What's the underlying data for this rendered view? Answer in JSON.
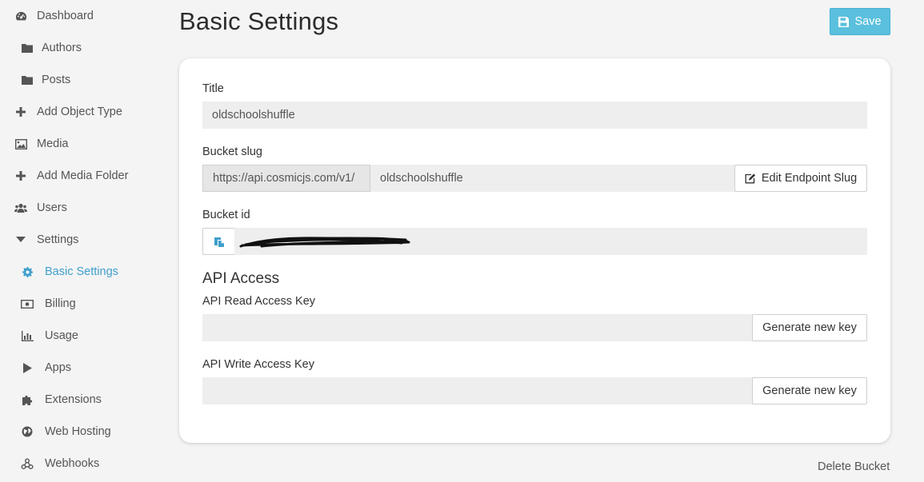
{
  "sidebar": {
    "items": [
      {
        "label": "Dashboard",
        "icon": "dashboard-icon"
      },
      {
        "label": "Authors",
        "icon": "folder-icon"
      },
      {
        "label": "Posts",
        "icon": "folder-icon"
      },
      {
        "label": "Add Object Type",
        "icon": "plus-icon"
      },
      {
        "label": "Media",
        "icon": "image-icon"
      },
      {
        "label": "Add Media Folder",
        "icon": "plus-icon"
      },
      {
        "label": "Users",
        "icon": "users-icon"
      },
      {
        "label": "Settings",
        "icon": "caret-down-icon"
      },
      {
        "label": "Basic Settings",
        "icon": "gear-icon",
        "active": true
      },
      {
        "label": "Billing",
        "icon": "money-icon"
      },
      {
        "label": "Usage",
        "icon": "bar-chart-icon"
      },
      {
        "label": "Apps",
        "icon": "play-icon"
      },
      {
        "label": "Extensions",
        "icon": "puzzle-icon"
      },
      {
        "label": "Web Hosting",
        "icon": "globe-icon"
      },
      {
        "label": "Webhooks",
        "icon": "webhook-icon"
      }
    ]
  },
  "header": {
    "title": "Basic Settings",
    "save_label": "Save"
  },
  "form": {
    "title_label": "Title",
    "title_value": "oldschoolshuffle",
    "slug_label": "Bucket slug",
    "slug_prefix": "https://api.cosmicjs.com/v1/",
    "slug_value": "oldschoolshuffle",
    "edit_slug_label": "Edit Endpoint Slug",
    "bucket_id_label": "Bucket id",
    "api_section_title": "API Access",
    "read_key_label": "API Read Access Key",
    "read_key_value": "",
    "write_key_label": "API Write Access Key",
    "write_key_value": "",
    "generate_label": "Generate new key"
  },
  "footer": {
    "delete_label": "Delete Bucket"
  },
  "colors": {
    "accent": "#3f9fcc",
    "save_button": "#5bc0de"
  }
}
